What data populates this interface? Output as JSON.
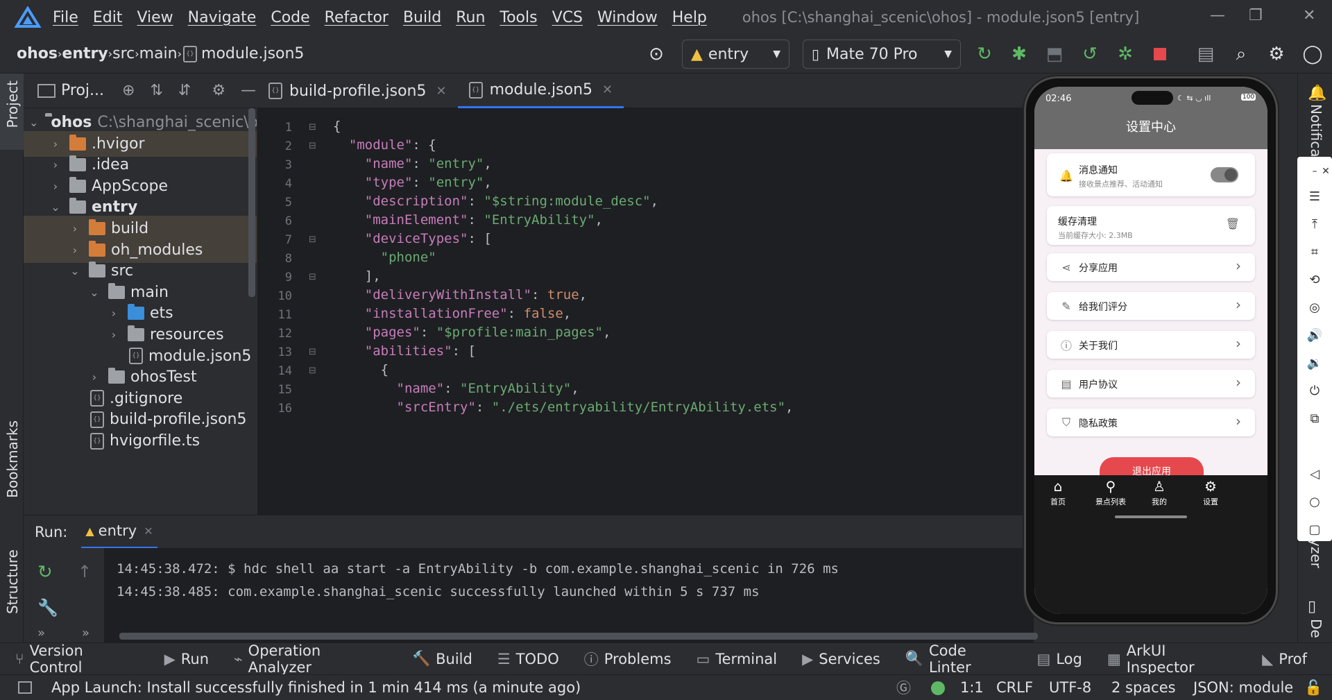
{
  "app": {
    "window_title": "ohos [C:\\shanghai_scenic\\ohos] - module.json5 [entry]",
    "menus": [
      "File",
      "Edit",
      "View",
      "Navigate",
      "Code",
      "Refactor",
      "Build",
      "Run",
      "Tools",
      "VCS",
      "Window",
      "Help"
    ]
  },
  "breadcrumb": [
    "ohos",
    "entry",
    "src",
    "main",
    "module.json5"
  ],
  "toolbar": {
    "run_config": "entry",
    "device": "Mate 70 Pro"
  },
  "project_panel": {
    "title": "Proj...",
    "tree": [
      {
        "label": "ohos",
        "extra": "C:\\shanghai_scenic\\ohos",
        "arrow": "⌄",
        "indent": 0,
        "type": "module",
        "bold": true,
        "hl": false
      },
      {
        "label": ".hvigor",
        "arrow": "›",
        "indent": 1,
        "type": "folder-orange",
        "hl": true
      },
      {
        "label": ".idea",
        "arrow": "›",
        "indent": 1,
        "type": "folder",
        "hl": false
      },
      {
        "label": "AppScope",
        "arrow": "›",
        "indent": 1,
        "type": "folder",
        "hl": false
      },
      {
        "label": "entry",
        "arrow": "⌄",
        "indent": 1,
        "type": "module",
        "bold": true,
        "hl": false
      },
      {
        "label": "build",
        "arrow": "›",
        "indent": 2,
        "type": "folder-orange",
        "hl": true
      },
      {
        "label": "oh_modules",
        "arrow": "›",
        "indent": 2,
        "type": "folder-orange",
        "hl": true
      },
      {
        "label": "src",
        "arrow": "⌄",
        "indent": 2,
        "type": "folder",
        "hl": false
      },
      {
        "label": "main",
        "arrow": "⌄",
        "indent": 3,
        "type": "folder",
        "hl": false
      },
      {
        "label": "ets",
        "arrow": "›",
        "indent": 4,
        "type": "folder-blue",
        "hl": false
      },
      {
        "label": "resources",
        "arrow": "›",
        "indent": 4,
        "type": "folder",
        "hl": false
      },
      {
        "label": "module.json5",
        "arrow": "",
        "indent": 4,
        "type": "file",
        "hl": false
      },
      {
        "label": "ohosTest",
        "arrow": "›",
        "indent": 3,
        "type": "folder",
        "hl": false
      },
      {
        "label": ".gitignore",
        "arrow": "",
        "indent": 2,
        "type": "file",
        "hl": false
      },
      {
        "label": "build-profile.json5",
        "arrow": "",
        "indent": 2,
        "type": "file",
        "hl": false
      },
      {
        "label": "hvigorfile.ts",
        "arrow": "",
        "indent": 2,
        "type": "file",
        "hl": false
      }
    ]
  },
  "editor": {
    "tabs": [
      {
        "label": "build-profile.json5",
        "active": false
      },
      {
        "label": "module.json5",
        "active": true
      }
    ],
    "lines": [
      {
        "n": "1",
        "html": "<span class='p'>{</span>"
      },
      {
        "n": "2",
        "html": "  <span class='k'>\"module\"</span><span class='p'>: {</span>"
      },
      {
        "n": "3",
        "html": "    <span class='k'>\"name\"</span><span class='p'>: </span><span class='s'>\"entry\"</span><span class='p'>,</span>"
      },
      {
        "n": "4",
        "html": "    <span class='k'>\"type\"</span><span class='p'>: </span><span class='s'>\"entry\"</span><span class='p'>,</span>"
      },
      {
        "n": "5",
        "html": "    <span class='k'>\"description\"</span><span class='p'>: </span><span class='s'>\"$string:module_desc\"</span><span class='p'>,</span>"
      },
      {
        "n": "6",
        "html": "    <span class='k'>\"mainElement\"</span><span class='p'>: </span><span class='s'>\"EntryAbility\"</span><span class='p'>,</span>"
      },
      {
        "n": "7",
        "html": "    <span class='k'>\"deviceTypes\"</span><span class='p'>: [</span>"
      },
      {
        "n": "8",
        "html": "      <span class='s'>\"phone\"</span>"
      },
      {
        "n": "9",
        "html": "    <span class='p'>],</span>"
      },
      {
        "n": "10",
        "html": "    <span class='k'>\"deliveryWithInstall\"</span><span class='p'>: </span><span class='b'>true</span><span class='p'>,</span>"
      },
      {
        "n": "11",
        "html": "    <span class='k'>\"installationFree\"</span><span class='p'>: </span><span class='b'>false</span><span class='p'>,</span>"
      },
      {
        "n": "12",
        "html": "    <span class='k'>\"pages\"</span><span class='p'>: </span><span class='s'>\"$profile:main_pages\"</span><span class='p'>,</span>"
      },
      {
        "n": "13",
        "html": "    <span class='k'>\"abilities\"</span><span class='p'>: [</span>"
      },
      {
        "n": "14",
        "html": "      <span class='p'>{</span>"
      },
      {
        "n": "15",
        "html": "        <span class='k'>\"name\"</span><span class='p'>: </span><span class='s'>\"EntryAbility\"</span><span class='p'>,</span>"
      },
      {
        "n": "16",
        "html": "        <span class='k'>\"srcEntry\"</span><span class='p'>: </span><span class='s'>\"./ets/entryability/EntryAbility.ets\"</span><span class='p'>,</span>"
      }
    ]
  },
  "run_panel": {
    "label": "Run:",
    "tab": "entry",
    "console": [
      "14:45:38.472: $ hdc shell aa start -a EntryAbility -b com.example.shanghai_scenic in 726 ms",
      "14:45:38.485: com.example.shanghai_scenic successfully launched within 5 s 737 ms"
    ]
  },
  "tool_windows": [
    "Version Control",
    "Run",
    "Operation Analyzer",
    "Build",
    "TODO",
    "Problems",
    "Terminal",
    "Services",
    "Code Linter",
    "Log",
    "ArkUI Inspector",
    "Prof"
  ],
  "status": {
    "message": "App Launch: Install successfully finished in 1 min 414 ms (a minute ago)",
    "position": "1:1",
    "line_sep": "CRLF",
    "encoding": "UTF-8",
    "indent": "2 spaces",
    "schema": "JSON: module"
  },
  "side_labels": {
    "project": "Project",
    "bookmarks": "Bookmarks",
    "structure": "Structure",
    "notifications": "Notifica",
    "analyzer": "yzer",
    "device": "De"
  },
  "phone": {
    "time": "02:46",
    "battery": "100",
    "page_title": "设置中心",
    "notify": {
      "title": "消息通知",
      "sub": "接收景点推荐、活动通知"
    },
    "cache": {
      "title": "缓存清理",
      "sub": "当前缓存大小: 2.3MB"
    },
    "items": [
      "分享应用",
      "给我们评分",
      "关于我们",
      "用户协议",
      "隐私政策"
    ],
    "logout": "退出应用",
    "nav": [
      "首页",
      "景点列表",
      "我的",
      "设置"
    ]
  },
  "colors": {
    "accent": "#3574f0",
    "run_green": "#5fb865",
    "danger": "#e5484d"
  }
}
